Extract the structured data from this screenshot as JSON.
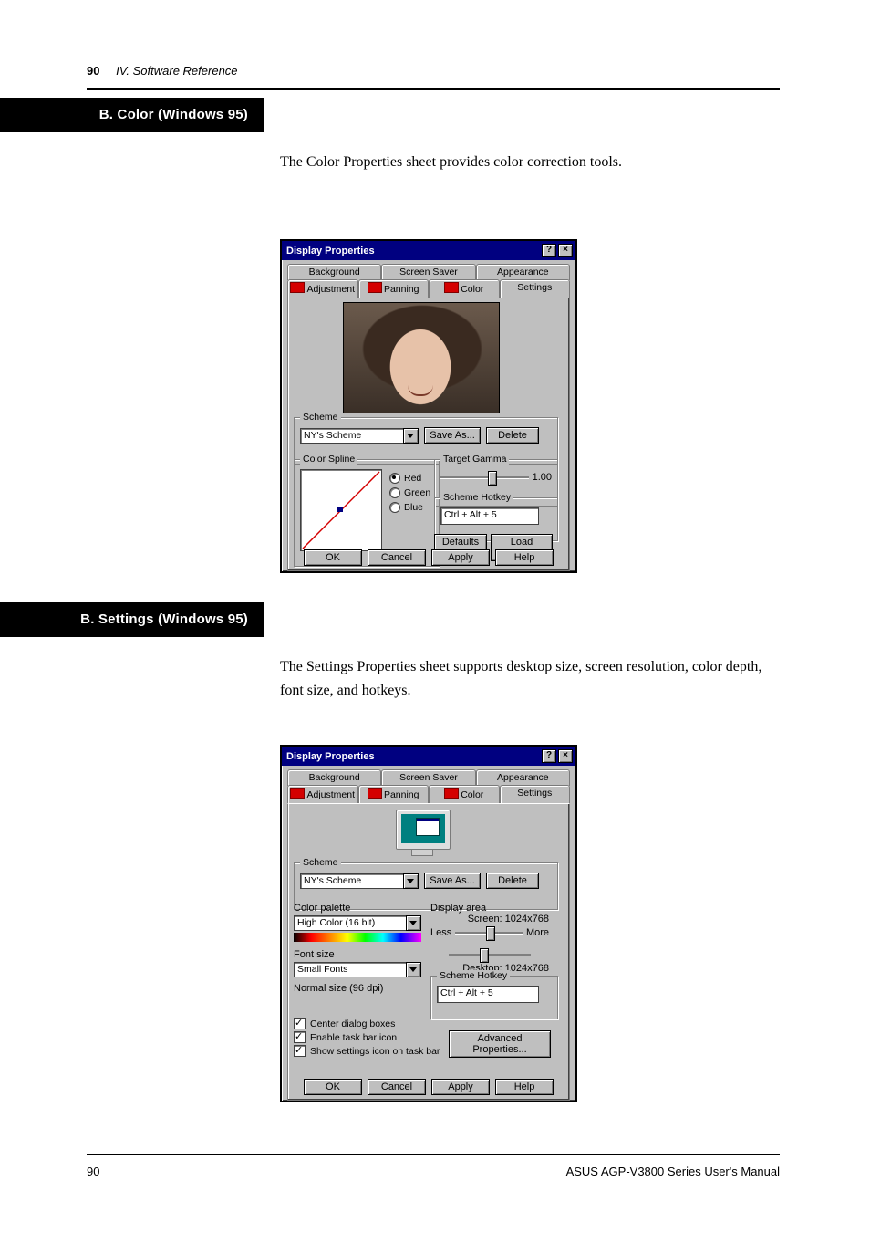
{
  "page": {
    "number": "90",
    "chapter": "IV. Software Reference"
  },
  "section1": {
    "heading": "B. Color (Windows 95)",
    "intro": "The Color Properties sheet provides color correction tools."
  },
  "section2": {
    "heading": "B. Settings (Windows 95)",
    "intro": "The Settings Properties sheet supports desktop size, screen resolution, color depth, font size, and hotkeys."
  },
  "footer": {
    "left": "90",
    "right": "ASUS AGP-V3800 Series User's Manual"
  },
  "dlg": {
    "title": "Display Properties",
    "tabs": {
      "row1": [
        "Background",
        "Screen Saver",
        "Appearance"
      ],
      "row2": [
        {
          "label": "Adjustment",
          "icon": true,
          "u": "A"
        },
        {
          "label": "Panning",
          "icon": true,
          "u": "P"
        },
        {
          "label": "Color",
          "icon": true
        },
        {
          "label": "Settings",
          "icon": false,
          "u": "S"
        }
      ]
    },
    "buttons": {
      "ok": "OK",
      "cancel": "Cancel",
      "apply": "Apply",
      "help": "Help"
    }
  },
  "color_tab": {
    "scheme_group": "Scheme",
    "scheme_value": "NY's Scheme",
    "save_as": "Save As...",
    "delete": "Delete",
    "spline_group": "Color Spline",
    "radios": {
      "red": "Red",
      "green": "Green",
      "blue": "Blue"
    },
    "target_gamma_group": "Target Gamma",
    "target_gamma_value": "1.00",
    "hotkey_group": "Scheme Hotkey",
    "hotkey_value": "Ctrl + Alt + 5",
    "defaults": "Defaults",
    "load_bitmap": "Load Bitmap..."
  },
  "settings_tab": {
    "scheme_group": "Scheme",
    "scheme_value": "NY's Scheme",
    "save_as": "Save As...",
    "delete": "Delete",
    "color_palette_label": "Color palette",
    "color_palette_value": "High Color (16 bit)",
    "font_size_label": "Font size",
    "font_size_value": "Small Fonts",
    "font_size_note": "Normal size (96 dpi)",
    "display_area_label": "Display area",
    "screen": "Screen: 1024x768",
    "less": "Less",
    "more": "More",
    "desktop": "Desktop: 1024x768",
    "hotkey_group": "Scheme Hotkey",
    "hotkey_value": "Ctrl + Alt + 5",
    "checks": {
      "center": "Center dialog boxes",
      "taskbar_icon": "Enable task bar icon",
      "show_icon": "Show settings icon on task bar"
    },
    "advanced": "Advanced Properties..."
  }
}
